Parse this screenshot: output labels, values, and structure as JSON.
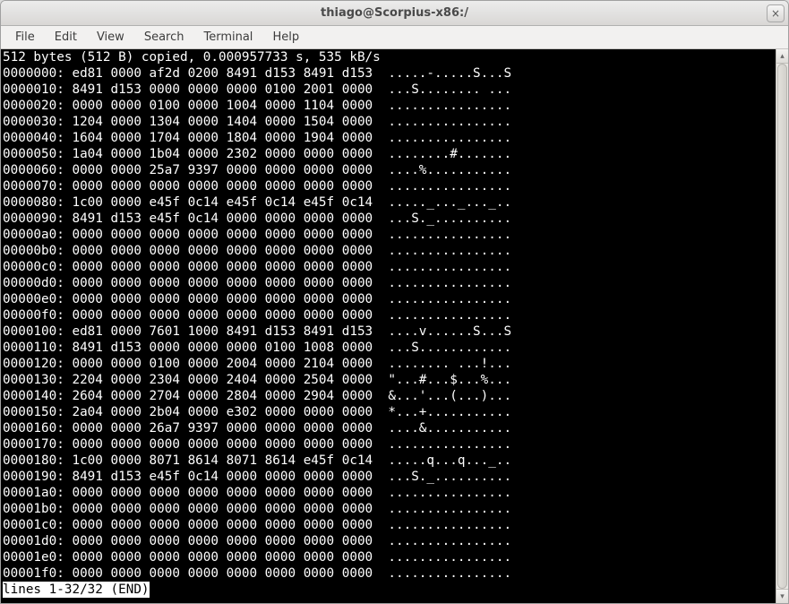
{
  "window": {
    "title": "thiago@Scorpius-x86:/",
    "close_glyph": "×"
  },
  "menubar": {
    "items": [
      "File",
      "Edit",
      "View",
      "Search",
      "Terminal",
      "Help"
    ]
  },
  "terminal": {
    "lines": [
      "512 bytes (512 B) copied, 0.000957733 s, 535 kB/s",
      "0000000: ed81 0000 af2d 0200 8491 d153 8491 d153  .....-.....S...S",
      "0000010: 8491 d153 0000 0000 0000 0100 2001 0000  ...S........ ...",
      "0000020: 0000 0000 0100 0000 1004 0000 1104 0000  ................",
      "0000030: 1204 0000 1304 0000 1404 0000 1504 0000  ................",
      "0000040: 1604 0000 1704 0000 1804 0000 1904 0000  ................",
      "0000050: 1a04 0000 1b04 0000 2302 0000 0000 0000  ........#.......",
      "0000060: 0000 0000 25a7 9397 0000 0000 0000 0000  ....%...........",
      "0000070: 0000 0000 0000 0000 0000 0000 0000 0000  ................",
      "0000080: 1c00 0000 e45f 0c14 e45f 0c14 e45f 0c14  ....._..._..._..",
      "0000090: 8491 d153 e45f 0c14 0000 0000 0000 0000  ...S._..........",
      "00000a0: 0000 0000 0000 0000 0000 0000 0000 0000  ................",
      "00000b0: 0000 0000 0000 0000 0000 0000 0000 0000  ................",
      "00000c0: 0000 0000 0000 0000 0000 0000 0000 0000  ................",
      "00000d0: 0000 0000 0000 0000 0000 0000 0000 0000  ................",
      "00000e0: 0000 0000 0000 0000 0000 0000 0000 0000  ................",
      "00000f0: 0000 0000 0000 0000 0000 0000 0000 0000  ................",
      "0000100: ed81 0000 7601 1000 8491 d153 8491 d153  ....v......S...S",
      "0000110: 8491 d153 0000 0000 0000 0100 1008 0000  ...S............",
      "0000120: 0000 0000 0100 0000 2004 0000 2104 0000  ........ ...!...",
      "0000130: 2204 0000 2304 0000 2404 0000 2504 0000  \"...#...$...%...",
      "0000140: 2604 0000 2704 0000 2804 0000 2904 0000  &...'...(...)...",
      "0000150: 2a04 0000 2b04 0000 e302 0000 0000 0000  *...+...........",
      "0000160: 0000 0000 26a7 9397 0000 0000 0000 0000  ....&...........",
      "0000170: 0000 0000 0000 0000 0000 0000 0000 0000  ................",
      "0000180: 1c00 0000 8071 8614 8071 8614 e45f 0c14  .....q...q..._..",
      "0000190: 8491 d153 e45f 0c14 0000 0000 0000 0000  ...S._..........",
      "00001a0: 0000 0000 0000 0000 0000 0000 0000 0000  ................",
      "00001b0: 0000 0000 0000 0000 0000 0000 0000 0000  ................",
      "00001c0: 0000 0000 0000 0000 0000 0000 0000 0000  ................",
      "00001d0: 0000 0000 0000 0000 0000 0000 0000 0000  ................",
      "00001e0: 0000 0000 0000 0000 0000 0000 0000 0000  ................",
      "00001f0: 0000 0000 0000 0000 0000 0000 0000 0000  ................"
    ],
    "status_line": "lines 1-32/32 (END)"
  },
  "scrollbar": {
    "up_glyph": "▴",
    "down_glyph": "▾"
  }
}
